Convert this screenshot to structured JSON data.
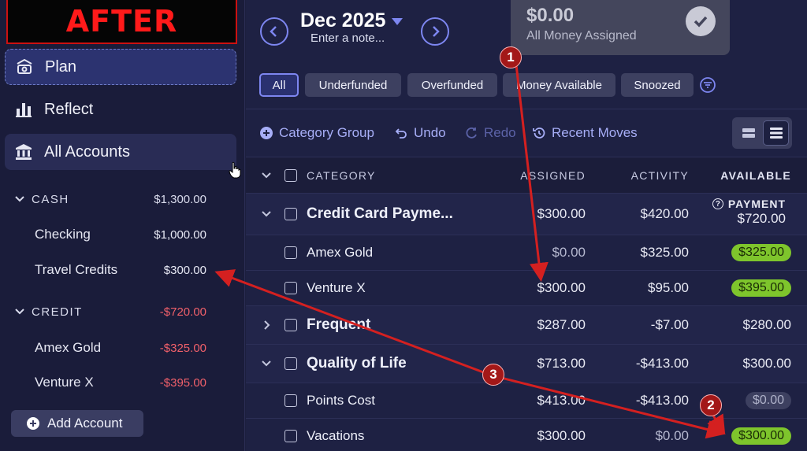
{
  "banner": {
    "text": "AFTER"
  },
  "nav": {
    "plan": "Plan",
    "reflect": "Reflect",
    "all_accounts": "All Accounts"
  },
  "accounts": {
    "cash": {
      "label": "CASH",
      "total": "$1,300.00",
      "items": [
        {
          "name": "Checking",
          "balance": "$1,000.00"
        },
        {
          "name": "Travel Credits",
          "balance": "$300.00"
        }
      ]
    },
    "credit": {
      "label": "CREDIT",
      "total": "-$720.00",
      "items": [
        {
          "name": "Amex Gold",
          "balance": "-$325.00"
        },
        {
          "name": "Venture X",
          "balance": "-$395.00"
        }
      ]
    },
    "add_account": "Add Account"
  },
  "header": {
    "month": "Dec 2025",
    "note_placeholder": "Enter a note...",
    "assigned_amount": "$0.00",
    "assigned_label": "All Money Assigned"
  },
  "filters": [
    "All",
    "Underfunded",
    "Overfunded",
    "Money Available",
    "Snoozed"
  ],
  "toolbar": {
    "category_group": "Category Group",
    "undo": "Undo",
    "redo": "Redo",
    "recent_moves": "Recent Moves"
  },
  "table": {
    "headers": {
      "category": "CATEGORY",
      "assigned": "ASSIGNED",
      "activity": "ACTIVITY",
      "available": "AVAILABLE"
    },
    "rows": [
      {
        "name": "Credit Card Payme...",
        "assigned": "$300.00",
        "activity": "$420.00",
        "available_label": "PAYMENT",
        "available": "$720.00"
      },
      {
        "name": "Amex Gold",
        "assigned": "$0.00",
        "activity": "$325.00",
        "available": "$325.00"
      },
      {
        "name": "Venture X",
        "assigned": "$300.00",
        "activity": "$95.00",
        "available": "$395.00"
      },
      {
        "name": "Frequent",
        "assigned": "$287.00",
        "activity": "-$7.00",
        "available": "$280.00"
      },
      {
        "name": "Quality of Life",
        "assigned": "$713.00",
        "activity": "-$413.00",
        "available": "$300.00"
      },
      {
        "name": "Points Cost",
        "assigned": "$413.00",
        "activity": "-$413.00",
        "available": "$0.00"
      },
      {
        "name": "Vacations",
        "assigned": "$300.00",
        "activity": "$0.00",
        "available": "$300.00"
      }
    ]
  },
  "annotations": {
    "badge1": "1",
    "badge2": "2",
    "badge3": "3"
  },
  "colors": {
    "accent": "#7d86f0",
    "positive_pill": "#7ec52c",
    "negative_text": "#f0606a",
    "annotation_red": "#d42020"
  }
}
